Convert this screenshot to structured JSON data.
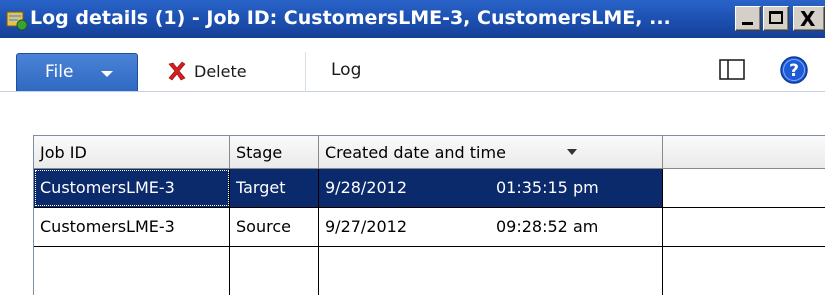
{
  "window": {
    "title": "Log details (1) - Job ID: CustomersLME-3, CustomersLME, ...",
    "minimize_icon": "minimize-icon",
    "maximize_icon": "maximize-icon",
    "close_glyph": "X"
  },
  "toolbar": {
    "file_label": "File",
    "delete_label": "Delete",
    "log_tab_label": "Log",
    "panel_icon": "panel-toggle-icon",
    "help_icon": "help-icon"
  },
  "grid": {
    "columns": [
      "Job ID",
      "Stage",
      "Created date and time"
    ],
    "sorted_column": "Created date and time",
    "rows": [
      {
        "job_id": "CustomersLME-3",
        "stage": "Target",
        "date": "9/28/2012",
        "time": "01:35:15 pm",
        "selected": true
      },
      {
        "job_id": "CustomersLME-3",
        "stage": "Source",
        "date": "9/27/2012",
        "time": "09:28:52 am",
        "selected": false
      }
    ]
  },
  "colors": {
    "titlebar": "#1b4fb0",
    "file_button": "#2f69c2",
    "selected_row": "#0a2a6b",
    "delete_icon": "#d81e1e",
    "help_icon": "#1e5bd6"
  }
}
